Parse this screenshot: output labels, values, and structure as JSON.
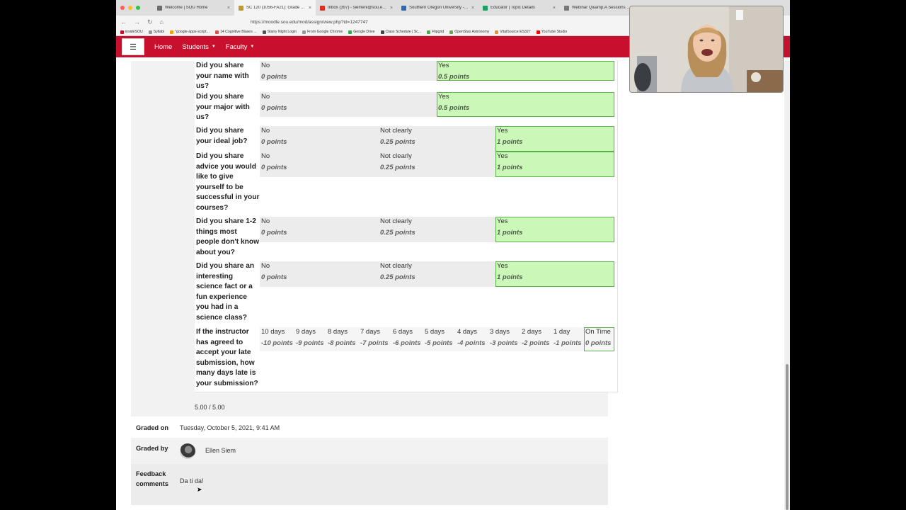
{
  "tabs": [
    {
      "title": "Welcome | SOU Home",
      "active": false,
      "color": "#6b6b6b"
    },
    {
      "title": "SC 120 (1056-FA21): Grade for ...",
      "active": true,
      "color": "#c29a2b"
    },
    {
      "title": "Inbox (397) - siemeni@sou.edu - ...",
      "active": false,
      "color": "#d93025"
    },
    {
      "title": "Southern Oregon University - C...",
      "active": false,
      "color": "#2a6db5"
    },
    {
      "title": "Educator | Topic Details",
      "active": false,
      "color": "#1aa260"
    },
    {
      "title": "Webinar Q&amp;A Sessions in the ...",
      "active": false,
      "color": "#777777"
    }
  ],
  "url": "https://moodle.sou.edu/mod/assign/view.php?id=1247747",
  "bookmarks": [
    {
      "label": "insideSOU",
      "color": "#c8102e"
    },
    {
      "label": "Syllabi",
      "color": "#999999"
    },
    {
      "label": "\"google-apps-script...",
      "color": "#f2a30f"
    },
    {
      "label": "14 Cognitive Biases ...",
      "color": "#d9534f"
    },
    {
      "label": "Starry Night Login",
      "color": "#555555"
    },
    {
      "label": "From Google Chrome",
      "color": "#999999"
    },
    {
      "label": "Google Drive",
      "color": "#34a853"
    },
    {
      "label": "Class Schedule | Sc...",
      "color": "#444444"
    },
    {
      "label": "Flipgrid",
      "color": "#47b04b"
    },
    {
      "label": "OpenStax Astronomy",
      "color": "#6aa84f"
    },
    {
      "label": "VitalSource ES327",
      "color": "#e69138"
    },
    {
      "label": "YouTube Studio",
      "color": "#ff0000"
    }
  ],
  "navbar": {
    "menu_icon": "☰",
    "home": "Home",
    "students": "Students",
    "faculty": "Faculty"
  },
  "criteria": [
    {
      "label": "Did you share your name with us?",
      "levels": [
        {
          "d": "No",
          "p": "0 points"
        },
        {
          "d": "Yes",
          "p": "0.5 points",
          "sel": true
        }
      ]
    },
    {
      "label": "Did you share your major with us?",
      "levels": [
        {
          "d": "No",
          "p": "0 points"
        },
        {
          "d": "Yes",
          "p": "0.5 points",
          "sel": true
        }
      ]
    },
    {
      "label": "Did you share your ideal job?",
      "levels": [
        {
          "d": "No",
          "p": "0 points"
        },
        {
          "d": "Not clearly",
          "p": "0.25 points"
        },
        {
          "d": "Yes",
          "p": "1 points",
          "sel": true
        }
      ]
    },
    {
      "label": "Did you share advice you would like to give yourself to be successful in your courses?",
      "levels": [
        {
          "d": "No",
          "p": "0 points"
        },
        {
          "d": "Not clearly",
          "p": "0.25 points"
        },
        {
          "d": "Yes",
          "p": "1 points",
          "sel": true
        }
      ]
    },
    {
      "label": "Did you share 1-2 things most people don't know about you?",
      "levels": [
        {
          "d": "No",
          "p": "0 points"
        },
        {
          "d": "Not clearly",
          "p": "0.25 points"
        },
        {
          "d": "Yes",
          "p": "1 points",
          "sel": true
        }
      ]
    },
    {
      "label": "Did you share an interesting science fact or a fun experience you had in a science class?",
      "levels": [
        {
          "d": "No",
          "p": "0 points"
        },
        {
          "d": "Not clearly",
          "p": "0.25 points"
        },
        {
          "d": "Yes",
          "p": "1 points",
          "sel": true
        }
      ]
    },
    {
      "label": "If the instructor has agreed to accept your late submission, how many days late is your submission?",
      "levels": [
        {
          "d": "10 days",
          "p": "-10 points"
        },
        {
          "d": "9 days",
          "p": "-9 points"
        },
        {
          "d": "8 days",
          "p": "-8 points"
        },
        {
          "d": "7 days",
          "p": "-7 points"
        },
        {
          "d": "6 days",
          "p": "-6 points"
        },
        {
          "d": "5 days",
          "p": "-5 points"
        },
        {
          "d": "4 days",
          "p": "-4 points"
        },
        {
          "d": "3 days",
          "p": "-3 points"
        },
        {
          "d": "2 days",
          "p": "-2 points"
        },
        {
          "d": "1 day",
          "p": "-1 points"
        },
        {
          "d": "On Time",
          "p": "0 points",
          "sel": true
        }
      ]
    }
  ],
  "score": "5.00 / 5.00",
  "graded_on": {
    "label": "Graded on",
    "value": "Tuesday, October 5, 2021, 9:41 AM"
  },
  "graded_by": {
    "label": "Graded by",
    "value": "Ellen Siem"
  },
  "feedback": {
    "label": "Feedback comments",
    "value": "Da ti da!"
  },
  "colors": {
    "brand": "#c8102e",
    "selected": "#cbf7b8",
    "selected_border": "#5cb04a"
  }
}
